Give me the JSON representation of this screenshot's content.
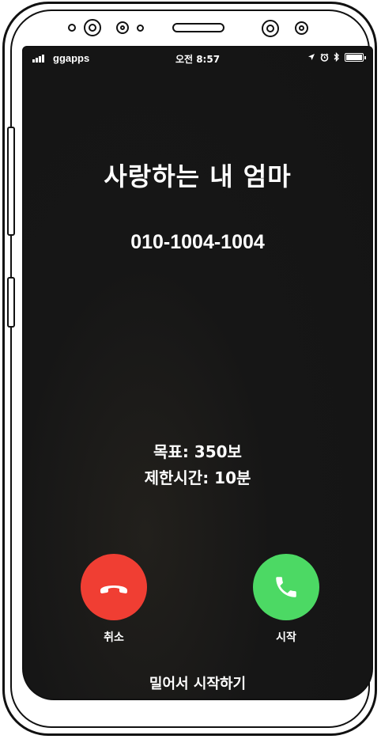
{
  "status_bar": {
    "carrier": "ggapps",
    "time": "오전 8:57",
    "icons": [
      "location-arrow-icon",
      "alarm-icon",
      "bluetooth-icon",
      "battery-icon"
    ]
  },
  "call": {
    "caller_name": "사랑하는 내 엄마",
    "phone_number": "010-1004-1004",
    "goal": "목표: 350보",
    "time_limit": "제한시간: 10분"
  },
  "actions": {
    "decline_label": "취소",
    "accept_label": "시작",
    "decline_color": "#f03e33",
    "accept_color": "#4cd964"
  },
  "slide_hint": "밀어서 시작하기"
}
